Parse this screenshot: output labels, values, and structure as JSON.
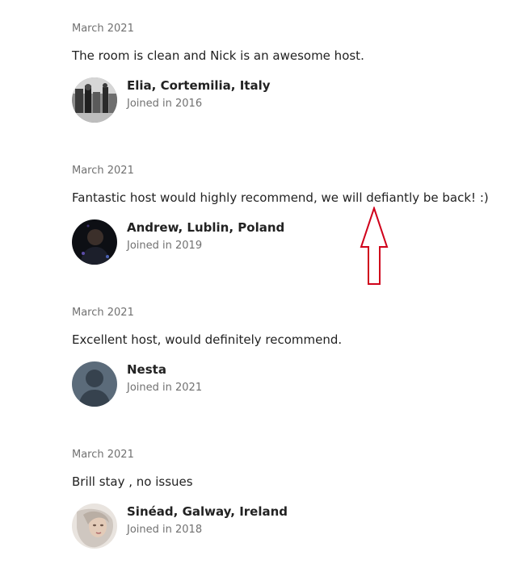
{
  "reviews": [
    {
      "date": "March 2021",
      "text": "The room is clean and Nick is an awesome host.",
      "reviewer_name": "Elia, Cortemilia, Italy",
      "joined": "Joined in 2016",
      "avatar_icon": "photo-avatar-grayscale"
    },
    {
      "date": "March 2021",
      "text": "Fantastic host would highly recommend, we will defiantly be back! :)",
      "reviewer_name": "Andrew, Lublin, Poland",
      "joined": "Joined in 2019",
      "avatar_icon": "photo-avatar-dark"
    },
    {
      "date": "March 2021",
      "text": "Excellent host, would definitely recommend.",
      "reviewer_name": "Nesta",
      "joined": "Joined in 2021",
      "avatar_icon": "default-user-silhouette"
    },
    {
      "date": "March 2021",
      "text": "Brill stay , no issues",
      "reviewer_name": "Sinéad, Galway, Ireland",
      "joined": "Joined in 2018",
      "avatar_icon": "photo-avatar-light"
    }
  ],
  "annotation": {
    "icon": "up-arrow-outline",
    "color": "#d0021b"
  },
  "colors": {
    "text_primary": "#222222",
    "text_secondary": "#717171",
    "avatar_placeholder": "#5b6b7a"
  }
}
